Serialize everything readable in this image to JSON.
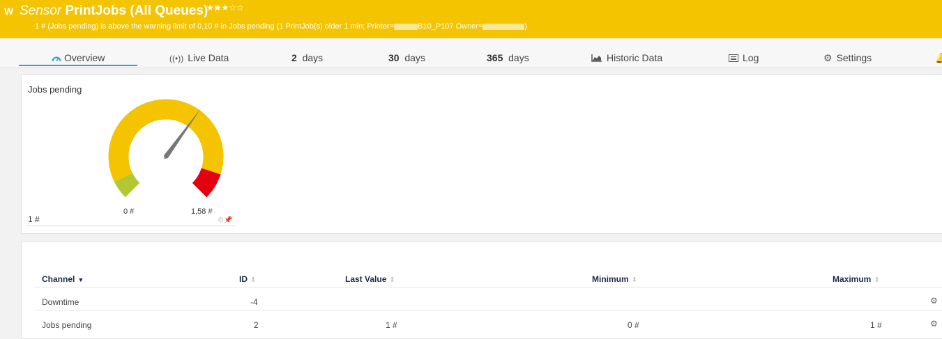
{
  "header": {
    "status_letter": "W",
    "type": "Sensor",
    "name": "PrintJobs (All Queues)",
    "flag_icon": "flag-outline",
    "stars": "★★★☆☆",
    "message_a": "1 # (Jobs pending) is above the warning limit of 0,10 # in Jobs pending (1 PrintJob(s) older 1 min; Printer=",
    "message_b": "B10_P107 Owner=",
    "message_c": ")",
    "color": "#f5c400"
  },
  "tabs": [
    {
      "label": "Overview",
      "icon": "gauge-icon"
    },
    {
      "label": "Live Data",
      "icon": "broadcast-icon"
    },
    {
      "num": "2",
      "label": "days"
    },
    {
      "num": "30",
      "label": "days"
    },
    {
      "num": "365",
      "label": "days"
    },
    {
      "label": "Historic Data",
      "icon": "area-chart-icon"
    },
    {
      "label": "Log",
      "icon": "list-icon"
    },
    {
      "label": "Settings",
      "icon": "gear-icon"
    }
  ],
  "gauge": {
    "title": "Jobs pending",
    "min_label": "0 #",
    "max_label": "1,58 #",
    "value_label": "1 #",
    "value": 1,
    "min": 0,
    "max": 1.58,
    "colors": {
      "ok": "#b2c831",
      "warn": "#f5c400",
      "error": "#e3000f",
      "needle": "#777777"
    }
  },
  "table": {
    "headers": {
      "channel": "Channel",
      "id": "ID",
      "last": "Last Value",
      "min": "Minimum",
      "max": "Maximum"
    },
    "rows": [
      {
        "channel": "Downtime",
        "id": "-4",
        "last": "",
        "min": "",
        "max": ""
      },
      {
        "channel": "Jobs pending",
        "id": "2",
        "last": "1 #",
        "min": "0 #",
        "max": "1 #"
      }
    ]
  }
}
